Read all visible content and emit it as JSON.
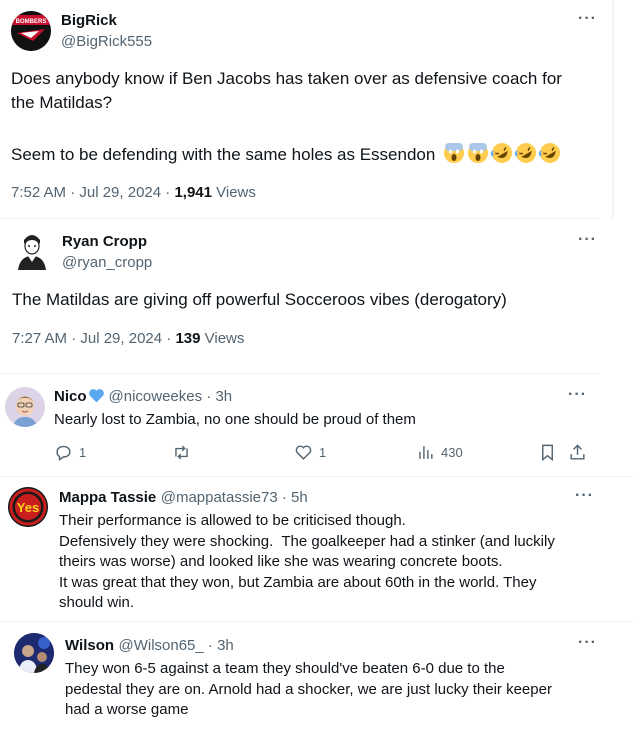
{
  "tweet1": {
    "name": "BigRick",
    "handle": "@BigRick555",
    "text_line1": "Does anybody know if Ben Jacobs has taken over as defensive coach for",
    "text_line2": "the Matildas?",
    "text_line3": "Seem to be defending with the same holes as Essendon",
    "emoji": [
      "scream",
      "scream",
      "rofl",
      "rofl",
      "rofl"
    ],
    "time": "7:52 AM · Jul 29, 2024 · ",
    "views_count": "1,941",
    "views_label": " Views",
    "avatar_text": "BOMBERS"
  },
  "tweet2": {
    "name": "Ryan Cropp",
    "handle": "@ryan_cropp",
    "text": "The Matildas are giving off powerful Socceroos vibes (derogatory)",
    "time": "7:27 AM · Jul 29, 2024 · ",
    "views_count": "139",
    "views_label": " Views"
  },
  "reply1": {
    "name": "Nico",
    "handle": "@nicoweekes · 3h",
    "text": "Nearly lost to Zambia, no one should be proud of them",
    "replies": "1",
    "retweets": "",
    "likes": "1",
    "views": "430"
  },
  "reply2": {
    "name": "Mappa Tassie",
    "handle": "@mappatassie73 · 5h",
    "avatar_text": "Yes",
    "lines": [
      "Their performance is allowed to be criticised though.",
      "Defensively they were shocking.  The goalkeeper had a stinker (and luckily",
      "theirs was worse) and looked like she was wearing concrete boots.",
      "It was great that they won, but Zambia are about 60th in the world. They",
      "should win."
    ]
  },
  "reply3": {
    "name": "Wilson",
    "handle": "@Wilson65_ · 3h",
    "lines": [
      "They won 6-5 against a team they should've beaten 6-0 due to the",
      "pedestal they are on. Arnold had a shocker, we are just lucky their keeper",
      "had a worse game"
    ]
  },
  "more_label": "···",
  "colors": {
    "text": "#0f1419",
    "secondary": "#536471",
    "divider": "#eff3f4",
    "heart": "#5aa8f0"
  },
  "icons": [
    "more-icon",
    "reply-icon",
    "retweet-icon",
    "like-icon",
    "views-icon",
    "bookmark-icon",
    "share-icon"
  ]
}
